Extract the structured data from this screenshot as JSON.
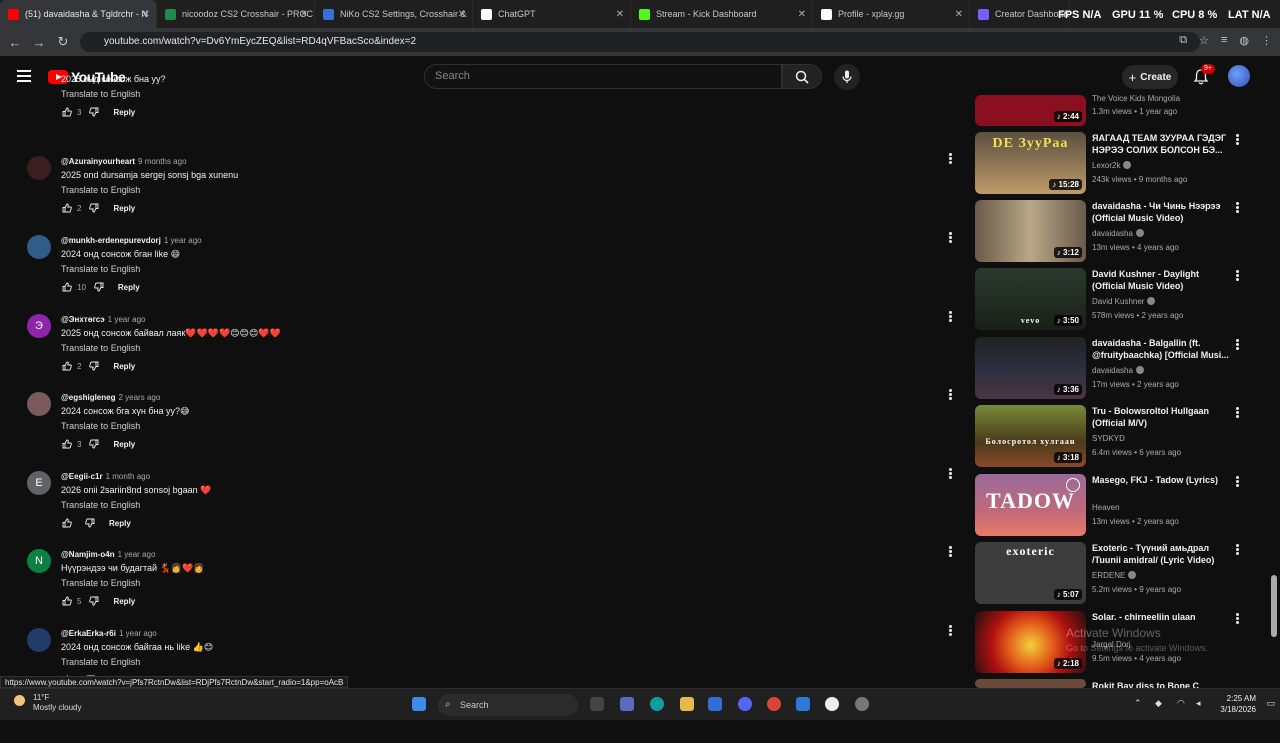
{
  "browser": {
    "tabs": [
      {
        "title": "(51) davaidasha & Tgldrchr - N",
        "active": true,
        "favicon_color": "#ff0000"
      },
      {
        "title": "nicoodoz CS2 Crosshair - PROC",
        "active": false,
        "favicon_color": "#1f8a4c"
      },
      {
        "title": "NiKo CS2 Settings, Crosshair &",
        "active": false,
        "favicon_color": "#3b6fd8"
      },
      {
        "title": "ChatGPT",
        "active": false,
        "favicon_color": "#ffffff"
      },
      {
        "title": "Stream - Kick Dashboard",
        "active": false,
        "favicon_color": "#53fc18"
      },
      {
        "title": "Profile - xplay.gg",
        "active": false,
        "favicon_color": "#ffffff"
      },
      {
        "title": "Creator Dashboard",
        "active": false,
        "favicon_color": "#7b5cff"
      }
    ],
    "url": "youtube.com/watch?v=Dv6YmEycZEQ&list=RD4qVFBacSco&index=2",
    "overlay": {
      "fps": "FPS N/A",
      "gpu": "GPU 11 %",
      "cpu": "CPU 8 %",
      "lat": "LAT N/A"
    }
  },
  "header": {
    "logo_text": "YouTube",
    "search_placeholder": "Search",
    "create_label": "Create",
    "notifications_badge": "9+"
  },
  "comments": [
    {
      "author": "",
      "time": "",
      "text": "2025 онд сонсож бна уу?",
      "translate": "Translate to English",
      "likes": "3",
      "reply": "Reply",
      "avatar_letter": "",
      "avatar_color": "#333333",
      "partial": true
    },
    {
      "author": "@Azurainyourheart",
      "time": "9 months ago",
      "text": "2025 ond dursamja sergej sonsj bga xunenu",
      "translate": "Translate to English",
      "likes": "2",
      "reply": "Reply",
      "avatar_letter": "",
      "avatar_color": "#3a1f1f"
    },
    {
      "author": "@munkh-erdenepurevdorj",
      "time": "1 year ago",
      "text": "2024 онд сонсож бган like 😄",
      "translate": "Translate to English",
      "likes": "10",
      "reply": "Reply",
      "avatar_letter": "",
      "avatar_color": "#2f5d8a"
    },
    {
      "author": "@Энхтөгсэ",
      "time": "1 year ago",
      "text": "2025 онд сонсож байвал лаяк❤️❤️❤️❤️😊😊😊❤️❤️",
      "translate": "Translate to English",
      "likes": "2",
      "reply": "Reply",
      "avatar_letter": "Э",
      "avatar_color": "#8e24aa"
    },
    {
      "author": "@egshigleneg",
      "time": "2 years ago",
      "text": "2024 сонсож бга хүн бна уу?😅",
      "translate": "Translate to English",
      "likes": "3",
      "reply": "Reply",
      "avatar_letter": "",
      "avatar_color": "#7a5a5a"
    },
    {
      "author": "@Eegii-c1r",
      "time": "1 month ago",
      "text": "2026 onii 2sariin8nd sonsoj bgaan ❤️",
      "translate": "Translate to English",
      "likes": "",
      "reply": "Reply",
      "avatar_letter": "E",
      "avatar_color": "#5f6368"
    },
    {
      "author": "@Namjim-o4n",
      "time": "1 year ago",
      "text": "Нүүрэндээ чи будагтай 💃👩❤️👩",
      "translate": "Translate to English",
      "likes": "5",
      "reply": "Reply",
      "avatar_letter": "N",
      "avatar_color": "#0b8043"
    },
    {
      "author": "@ErkaErka-r6i",
      "time": "1 year ago",
      "text": "2024 онд сонсож байгаа нь like 👍😊",
      "translate": "Translate to English",
      "likes": "",
      "reply": "Reply",
      "avatar_letter": "",
      "avatar_color": "#223a6a"
    }
  ],
  "recommendations": [
    {
      "title": "",
      "channel": "The Voice Kids Mongolia",
      "verified": false,
      "meta": "1.3m views • 1 year ago",
      "duration": "2:44",
      "thumb_color": "#8a1020",
      "partial": true
    },
    {
      "title": "ЯАГААД TEAM ЗУУРАА ГЭДЭГ НЭРЭЭ СОЛИХ БОЛСОН БЭ...",
      "channel": "Lexor2k",
      "verified": true,
      "meta": "243k views • 9 months ago",
      "duration": "15:28",
      "thumb_color": "#c8a060",
      "thumb_text": "DE ЗууРаа"
    },
    {
      "title": "davaidasha - Чи Чинь Нээрээ (Official Music Video)",
      "channel": "davaidasha",
      "verified": true,
      "meta": "13m views • 4 years ago",
      "duration": "3:12",
      "thumb_color": "#8a7a62"
    },
    {
      "title": "David Kushner - Daylight (Official Music Video)",
      "channel": "David Kushner",
      "verified": true,
      "meta": "578m views • 2 years ago",
      "duration": "3:50",
      "thumb_color": "#2e3a30",
      "thumb_text": "vevo"
    },
    {
      "title": "davaidasha - Balgallin (ft. @fruitybaachka) [Official Musi...",
      "channel": "davaidasha",
      "verified": true,
      "meta": "17m views • 2 years ago",
      "duration": "3:36",
      "thumb_color": "#3a3a48"
    },
    {
      "title": "Tru - Bolowsroltol Hullgaan (Official M/V)",
      "channel": "SYDKYD",
      "verified": false,
      "meta": "6.4m views • 6 years ago",
      "duration": "3:18",
      "thumb_color": "#5a5a30",
      "thumb_text": "Болосротол хулгаан"
    },
    {
      "title": "Masego, FKJ - Tadow (Lyrics)",
      "channel": "Heaven",
      "verified": false,
      "meta": "13m views • 2 years ago",
      "duration": "",
      "thumb_color": "#7a5070",
      "thumb_text": "TADOW"
    },
    {
      "title": "Exoteric - Түүний амьдрал /Tuunii amidral/ (Lyric Video)",
      "channel": "ERDENE",
      "verified": true,
      "meta": "5.2m views • 9 years ago",
      "duration": "5:07",
      "thumb_color": "#3a3a3a",
      "thumb_text": "exoteric"
    },
    {
      "title": "Solar. - chirneeliin ulaan",
      "channel": "Jargal Dorj",
      "verified": false,
      "meta": "9.5m views • 4 years ago",
      "duration": "2:18",
      "thumb_color": "#c01818"
    },
    {
      "title": "Rokit Bay diss to Bone C",
      "channel": "",
      "verified": false,
      "meta": "",
      "duration": "",
      "thumb_color": "#6a4a3a",
      "partial": true
    }
  ],
  "status_url": "https://www.youtube.com/watch?v=jPfs7RctnDw&list=RDjPfs7RctnDw&start_radio=1&pp=oAcB",
  "watermark": {
    "line1": "Activate Windows",
    "line2": "Go to Settings to activate Windows."
  },
  "taskbar": {
    "weather_temp": "11°F",
    "weather_desc": "Mostly cloudy",
    "search_label": "Search",
    "time": "2:25 AM",
    "date": "3/18/2026"
  }
}
